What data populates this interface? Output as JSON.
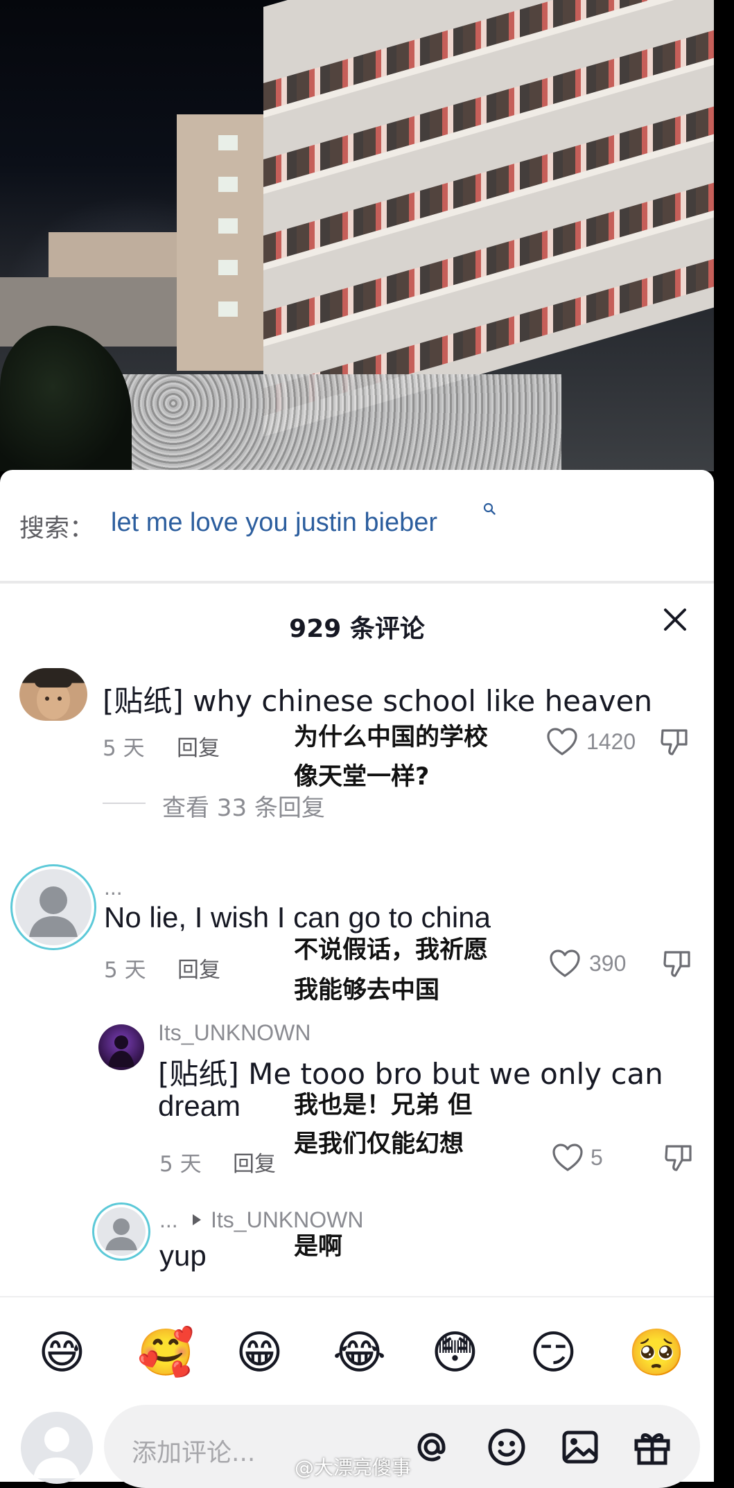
{
  "search": {
    "prefix": "搜索：",
    "query": "let me love you justin bieber"
  },
  "comments_header": {
    "count_title": "929 条评论"
  },
  "comments": [
    {
      "text": "[贴纸] why chinese school like heaven",
      "time": "5 天",
      "reply_label": "回复",
      "likes": "1420",
      "translation_line1": "为什么中国的学校",
      "translation_line2": "像天堂一样?",
      "view_replies": "查看 33 条回复"
    },
    {
      "username": "...",
      "text": "No lie, I wish I can go to china",
      "time": "5 天",
      "reply_label": "回复",
      "likes": "390",
      "translation_line1": "不说假话，我祈愿",
      "translation_line2": "我能够去中国"
    },
    {
      "username": "Its_UNKNOWN",
      "text_line1": "[贴纸] Me tooo bro but we only can",
      "text_line2": "dream",
      "time": "5 天",
      "reply_label": "回复",
      "likes": "5",
      "translation_line1": "我也是！兄弟 但",
      "translation_line2": "是我们仅能幻想"
    },
    {
      "username": "...",
      "reply_to": "Its_UNKNOWN",
      "text": "yup",
      "translation": "是啊"
    }
  ],
  "emoji_bar": [
    "😅",
    "🥰",
    "😁",
    "😂",
    "😳",
    "😏",
    "🥺"
  ],
  "input": {
    "placeholder": "添加评论..."
  },
  "watermark": "@大漂亮傻事",
  "icons": [
    "search-icon",
    "close-icon",
    "heart-icon",
    "dislike-icon",
    "mention-icon",
    "emoji-icon",
    "image-icon",
    "gift-icon",
    "weibo-icon"
  ]
}
